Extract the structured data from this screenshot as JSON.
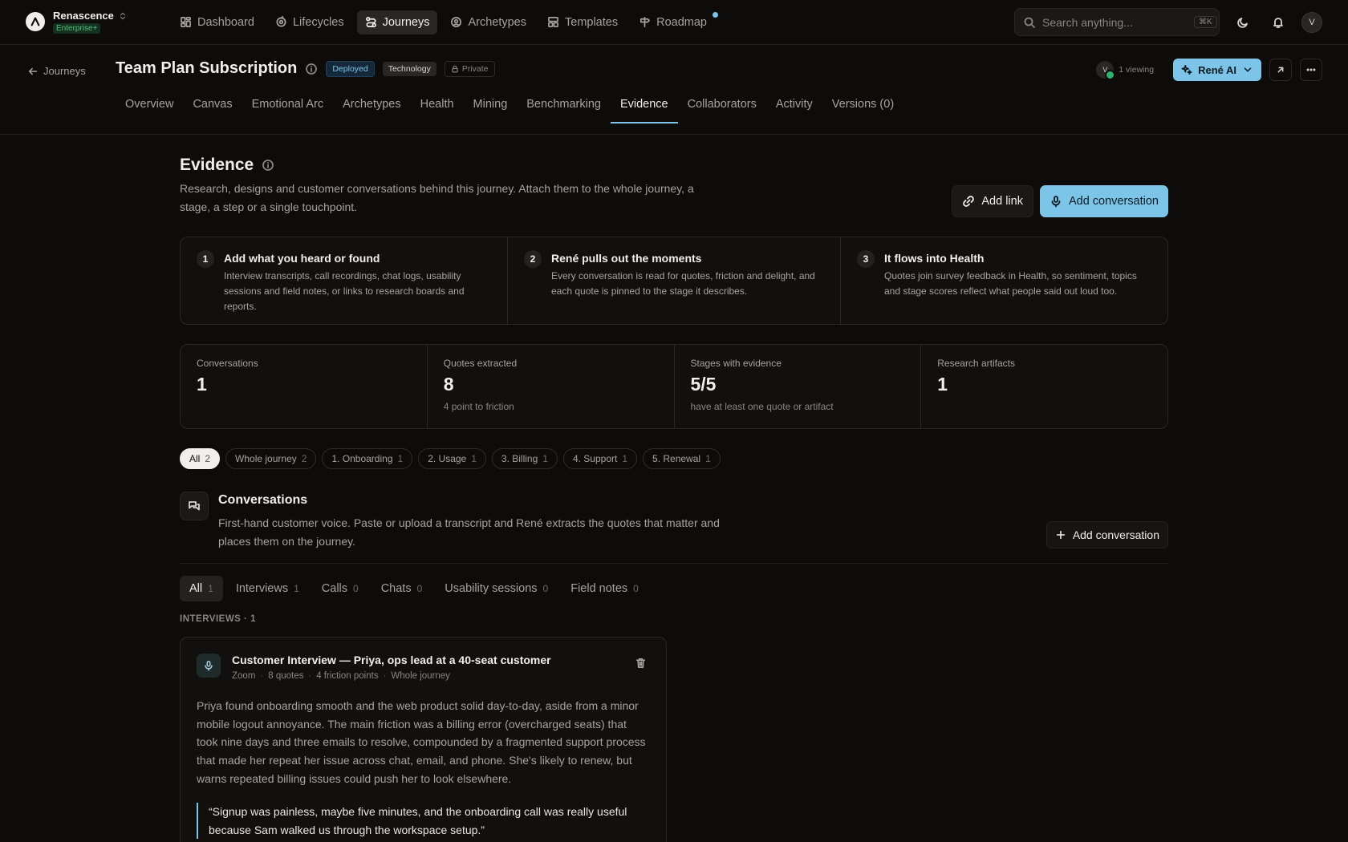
{
  "brand": {
    "name": "Renascence",
    "tier": "Enterprise+"
  },
  "nav": [
    {
      "label": "Dashboard",
      "icon": "grid-icon"
    },
    {
      "label": "Lifecycles",
      "icon": "cycle-icon"
    },
    {
      "label": "Journeys",
      "icon": "route-icon",
      "active": true
    },
    {
      "label": "Archetypes",
      "icon": "user-circle-icon"
    },
    {
      "label": "Templates",
      "icon": "template-icon"
    },
    {
      "label": "Roadmap",
      "icon": "signpost-icon"
    }
  ],
  "search": {
    "placeholder": "Search anything...",
    "shortcut": "⌘K"
  },
  "user": {
    "initial": "V"
  },
  "header": {
    "back_label": "Journeys",
    "title": "Team Plan Subscription",
    "badges": {
      "deployed": "Deployed",
      "category": "Technology",
      "visibility": "Private"
    },
    "viewing": {
      "initial": "V",
      "label": "1 viewing"
    },
    "ai_button": "René AI"
  },
  "tabs": [
    "Overview",
    "Canvas",
    "Emotional Arc",
    "Archetypes",
    "Health",
    "Mining",
    "Benchmarking",
    "Evidence",
    "Collaborators",
    "Activity",
    "Versions (0)"
  ],
  "active_tab": "Evidence",
  "evidence": {
    "title": "Evidence",
    "description": "Research, designs and customer conversations behind this journey. Attach them to the whole journey, a stage, a step or a single touchpoint.",
    "add_link": "Add link",
    "add_conversation": "Add conversation"
  },
  "steps": [
    {
      "num": "1",
      "title": "Add what you heard or found",
      "desc": "Interview transcripts, call recordings, chat logs, usability sessions and field notes, or links to research boards and reports."
    },
    {
      "num": "2",
      "title": "René pulls out the moments",
      "desc": "Every conversation is read for quotes, friction and delight, and each quote is pinned to the stage it describes."
    },
    {
      "num": "3",
      "title": "It flows into Health",
      "desc": "Quotes join survey feedback in Health, so sentiment, topics and stage scores reflect what people said out loud too."
    }
  ],
  "stats": [
    {
      "label": "Conversations",
      "value": "1",
      "sub": ""
    },
    {
      "label": "Quotes extracted",
      "value": "8",
      "sub": "4 point to friction"
    },
    {
      "label": "Stages with evidence",
      "value": "5/5",
      "sub": "have at least one quote or artifact"
    },
    {
      "label": "Research artifacts",
      "value": "1",
      "sub": ""
    }
  ],
  "filters": [
    {
      "label": "All",
      "count": "2",
      "active": true
    },
    {
      "label": "Whole journey",
      "count": "2"
    },
    {
      "label": "1. Onboarding",
      "count": "1"
    },
    {
      "label": "2. Usage",
      "count": "1"
    },
    {
      "label": "3. Billing",
      "count": "1"
    },
    {
      "label": "4. Support",
      "count": "1"
    },
    {
      "label": "5. Renewal",
      "count": "1"
    }
  ],
  "conversations": {
    "title": "Conversations",
    "description": "First-hand customer voice. Paste or upload a transcript and René extracts the quotes that matter and places them on the journey.",
    "add_label": "Add conversation",
    "subtabs": [
      {
        "label": "All",
        "count": "1",
        "active": true
      },
      {
        "label": "Interviews",
        "count": "1"
      },
      {
        "label": "Calls",
        "count": "0"
      },
      {
        "label": "Chats",
        "count": "0"
      },
      {
        "label": "Usability sessions",
        "count": "0"
      },
      {
        "label": "Field notes",
        "count": "0"
      }
    ],
    "group_label": "INTERVIEWS · 1",
    "card": {
      "title": "Customer Interview — Priya, ops lead at a 40-seat customer",
      "meta": [
        "Zoom",
        "8 quotes",
        "4 friction points",
        "Whole journey"
      ],
      "summary": "Priya found onboarding smooth and the web product solid day-to-day, aside from a minor mobile logout annoyance. The main friction was a billing error (overcharged seats) that took nine days and three emails to resolve, compounded by a fragmented support process that made her repeat her issue across chat, email, and phone. She's likely to renew, but warns repeated billing issues could push her to look elsewhere.",
      "quote": "“Signup was painless, maybe five minutes, and the onboarding call was really useful because Sam walked us through the workspace setup.”"
    }
  },
  "colors": {
    "accent": "#7cc4e8",
    "background": "#0e0c0b",
    "live": "#2fb36a"
  }
}
